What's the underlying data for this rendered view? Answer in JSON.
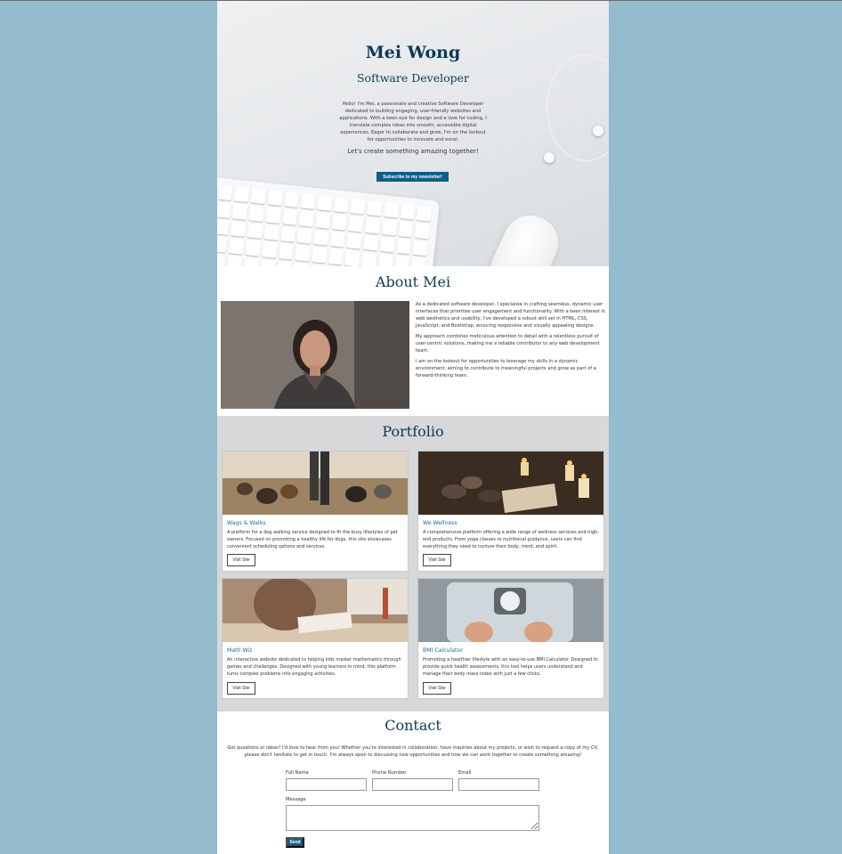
{
  "hero": {
    "name": "Mei Wong",
    "role": "Software Developer",
    "bio": "Hello! I'm Mei, a passionate and creative Software Developer dedicated to building engaging, user-friendly websites and applications. With a keen eye for design and a love for coding, I translate complex ideas into smooth, accessible digital experiences. Eager to collaborate and grow, I'm on the lookout for opportunities to innovate and excel.",
    "tagline": "Let's create something amazing together!",
    "subscribe_label": "Subscribe to my newsletter!"
  },
  "about": {
    "title": "About Mei",
    "paragraphs": [
      "As a dedicated software developer, I specialise in crafting seamless, dynamic user interfaces that prioritise user engagement and functionality. With a keen interest in web aesthetics and usability, I've developed a robust skill set in HTML, CSS, JavaScript, and Bootstrap, ensuring responsive and visually appealing designs.",
      "My approach combines meticulous attention to detail with a relentless pursuit of user-centric solutions, making me a reliable contributor to any web development team.",
      "I am on the lookout for opportunities to leverage my skills in a dynamic environment, aiming to contribute to meaningful projects and grow as part of a forward-thinking team."
    ]
  },
  "portfolio": {
    "title": "Portfolio",
    "projects": [
      {
        "title": "Wags & Walks",
        "description": "A platform for a dog walking service designed to fit the busy lifestyles of pet owners. Focused on promoting a healthy life for dogs, this site showcases convenient scheduling options and services.",
        "button": "Visit Site"
      },
      {
        "title": "We Wellness",
        "description": "A comprehensive platform offering a wide range of wellness services and high-end products. From yoga classes to nutritional guidance, users can find everything they need to nurture their body, mind, and spirit.",
        "button": "Visit Site"
      },
      {
        "title": "Math Wiz",
        "description": "An interactive website dedicated to helping kids master mathematics through games and challenges. Designed with young learners in mind, this platform turns complex problems into engaging activities.",
        "button": "Visit Site"
      },
      {
        "title": "BMI Calculator",
        "description": "Promoting a healthier lifestyle with an easy-to-use BMI Calculator. Designed to provide quick health assessments, this tool helps users understand and manage their body mass index with just a few clicks.",
        "button": "Visit Site"
      }
    ]
  },
  "contact": {
    "title": "Contact",
    "intro": "Got questions or ideas? I'd love to hear from you! Whether you're interested in collaboration, have inquiries about my projects, or wish to request a copy of my CV, please don't hesitate to get in touch. I'm always open to discussing new opportunities and how we can work together to create something amazing!",
    "full_name_label": "Full Name",
    "phone_label": "Phone Number",
    "email_label": "Email",
    "message_label": "Message",
    "send_label": "Send"
  },
  "colors": {
    "background": "#94bccd",
    "heading": "#0d3a52",
    "accent": "#0f5e85",
    "link": "#1a6e99",
    "portfolio_bg": "#d6d8da"
  }
}
